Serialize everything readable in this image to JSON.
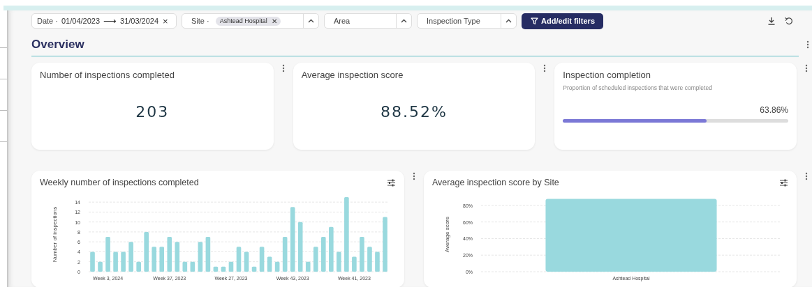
{
  "filters": [
    {
      "kind": "date",
      "label": "Date ·",
      "from": "01/04/2023",
      "arrow": "⟶",
      "to": "31/03/2024",
      "clear": "×"
    },
    {
      "kind": "select",
      "label": "Site ·",
      "chips": [
        {
          "text": "Ashtead Hospital",
          "remove": "✕"
        }
      ]
    },
    {
      "kind": "select",
      "label": "Area"
    },
    {
      "kind": "select",
      "label": "Inspection Type"
    }
  ],
  "add_filters_button": "Add/edit filters",
  "section_title": "Overview",
  "kpi_cards": [
    {
      "kind": "number",
      "title": "Number of inspections completed",
      "value": "203"
    },
    {
      "kind": "number",
      "title": "Average inspection score",
      "value": "88.52%"
    },
    {
      "kind": "progress",
      "title": "Inspection completion",
      "subtitle": "Proportion of scheduled inspections that were completed",
      "reading": "63.86%",
      "level": 0.6386
    }
  ],
  "chart_cards": [
    {
      "title": "Weekly number of inspections completed",
      "chart_data": {
        "type": "bar",
        "ylabel": "Number of inspections",
        "values": [
          4,
          2,
          7,
          4,
          4,
          6,
          2,
          8,
          5,
          5,
          7,
          6,
          2,
          2,
          6,
          7,
          1,
          1,
          2,
          5,
          4,
          1,
          5,
          3,
          2,
          7,
          13,
          10,
          2,
          5,
          7,
          9,
          4,
          15,
          3,
          7,
          5,
          4,
          11
        ],
        "categories": [
          null,
          null,
          "Week 3, 2024",
          null,
          null,
          null,
          null,
          null,
          null,
          null,
          "Week 37, 2023",
          null,
          null,
          null,
          null,
          null,
          null,
          null,
          "Week 27, 2023",
          null,
          null,
          null,
          null,
          null,
          null,
          null,
          "Week 43, 2023",
          null,
          null,
          null,
          null,
          null,
          null,
          null,
          "Week 41, 2023",
          null,
          null,
          null,
          null
        ],
        "grid": true,
        "ylim": [
          0,
          15
        ],
        "yticks": [
          0,
          2,
          4,
          6,
          8,
          10,
          12,
          14
        ]
      }
    },
    {
      "title": "Average inspection score by Site",
      "chart_data": {
        "type": "bar",
        "ylabel": "Average score",
        "categories": [
          "Ashtead Hospital"
        ],
        "values": [
          88
        ],
        "grid": true,
        "ylim": [
          0,
          90
        ],
        "yticks": [
          {
            "value": 0,
            "label": "0%"
          },
          {
            "value": 20,
            "label": "20%"
          },
          {
            "value": 40,
            "label": "40%"
          },
          {
            "value": 60,
            "label": "60%"
          },
          {
            "value": 80,
            "label": "80%"
          }
        ]
      }
    }
  ]
}
